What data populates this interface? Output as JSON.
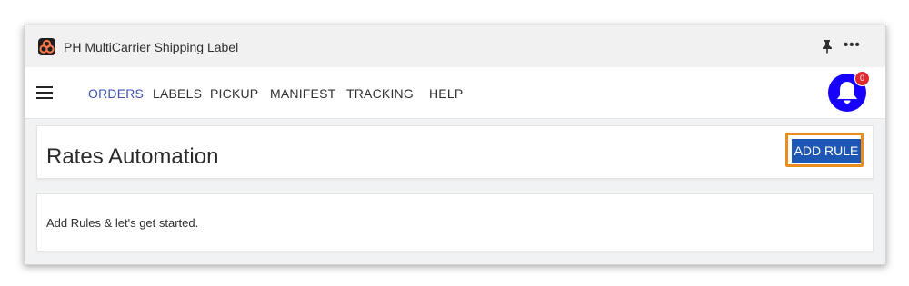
{
  "window": {
    "title": "PH MultiCarrier Shipping Label",
    "icons": [
      "app-logo",
      "pin-icon",
      "more-options-icon"
    ]
  },
  "nav": {
    "menu_icon": "hamburger-menu-icon",
    "items": [
      {
        "label": "ORDERS",
        "active": true
      },
      {
        "label": "LABELS",
        "active": false
      },
      {
        "label": "PICKUP",
        "active": false
      },
      {
        "label": "MANIFEST",
        "active": false
      },
      {
        "label": "TRACKING",
        "active": false
      },
      {
        "label": "HELP",
        "active": false
      }
    ],
    "notifications": {
      "icon": "bell-icon",
      "count": "0",
      "color": "#1800ff",
      "badge_color": "#e0292f"
    }
  },
  "page": {
    "title": "Rates Automation",
    "add_rule_label": "ADD RULE",
    "empty_message": "Add Rules & let's get started.",
    "accent_color": "#3f51b5",
    "button_color": "#1d56b3",
    "highlight_color": "#ea8d1f"
  }
}
